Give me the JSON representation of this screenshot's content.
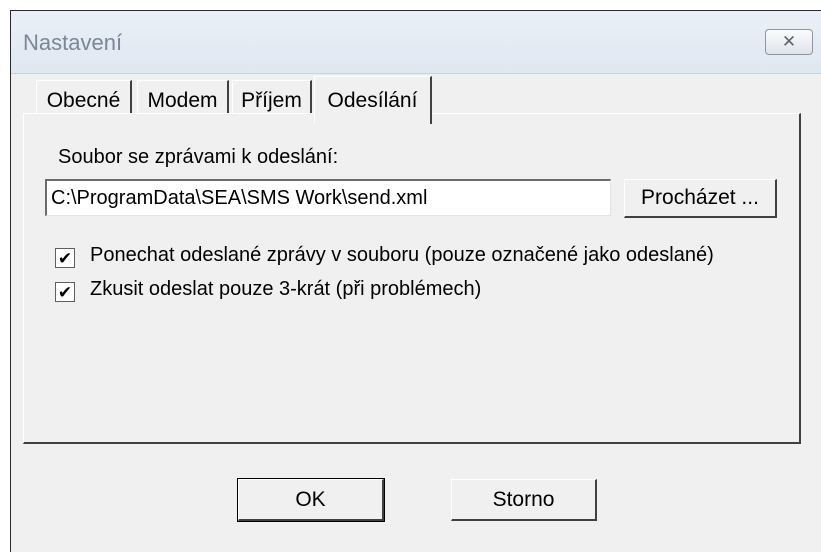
{
  "window": {
    "title": "Nastavení",
    "close_glyph": "✕"
  },
  "tabs": [
    {
      "label": "Obecné",
      "active": false
    },
    {
      "label": "Modem",
      "active": false
    },
    {
      "label": "Příjem",
      "active": false
    },
    {
      "label": "Odesílání",
      "active": true
    }
  ],
  "panel": {
    "file_label": "Soubor se zprávami k odeslání:",
    "file_path": "C:\\ProgramData\\SEA\\SMS Work\\send.xml",
    "browse_label": "Procházet ...",
    "checkboxes": [
      {
        "label": "Ponechat odeslané zprávy v souboru (pouze označené jako odeslané)",
        "checked": true
      },
      {
        "label": "Zkusit odeslat pouze 3-krát (při problémech)",
        "checked": true
      }
    ]
  },
  "buttons": {
    "ok_label": "OK",
    "cancel_label": "Storno"
  },
  "check_glyph": "✔"
}
